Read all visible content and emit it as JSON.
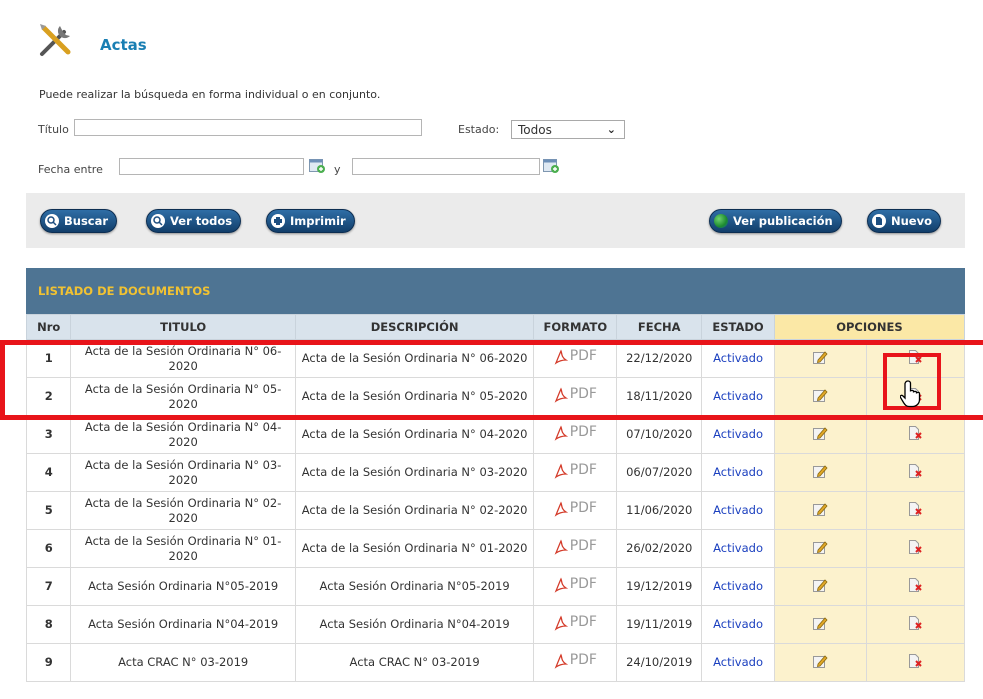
{
  "header": {
    "title": "Actas",
    "icon": "tools-icon"
  },
  "search": {
    "instructions": "Puede realizar la búsqueda en forma individual o en conjunto.",
    "titulo_label": "Título",
    "titulo_value": "",
    "estado_label": "Estado:",
    "estado_value": "Todos",
    "fecha_label": "Fecha entre",
    "fecha_from": "",
    "y_label": "y",
    "fecha_to": ""
  },
  "toolbar": {
    "buscar": "Buscar",
    "ver_todos": "Ver todos",
    "imprimir": "Imprimir",
    "ver_publicacion": "Ver publicación",
    "nuevo": "Nuevo"
  },
  "table": {
    "title": "LISTADO DE DOCUMENTOS",
    "headers": [
      "Nro",
      "TITULO",
      "DESCRIPCIÓN",
      "FORMATO",
      "FECHA",
      "ESTADO",
      "OPCIONES"
    ],
    "format_label": "PDF",
    "rows": [
      {
        "nro": "1",
        "titulo": "Acta de la Sesión Ordinaria N° 06-2020",
        "descripcion": "Acta de la Sesión Ordinaria N° 06-2020",
        "fecha": "22/12/2020",
        "estado": "Activado"
      },
      {
        "nro": "2",
        "titulo": "Acta de la Sesión Ordinaria N° 05-2020",
        "descripcion": "Acta de la Sesión Ordinaria N° 05-2020",
        "fecha": "18/11/2020",
        "estado": "Activado"
      },
      {
        "nro": "3",
        "titulo": "Acta de la Sesión Ordinaria N° 04-2020",
        "descripcion": "Acta de la Sesión Ordinaria N° 04-2020",
        "fecha": "07/10/2020",
        "estado": "Activado"
      },
      {
        "nro": "4",
        "titulo": "Acta de la Sesión Ordinaria N° 03-2020",
        "descripcion": "Acta de la Sesión Ordinaria N° 03-2020",
        "fecha": "06/07/2020",
        "estado": "Activado"
      },
      {
        "nro": "5",
        "titulo": "Acta de la Sesión Ordinaria N° 02-2020",
        "descripcion": "Acta de la Sesión Ordinaria N° 02-2020",
        "fecha": "11/06/2020",
        "estado": "Activado"
      },
      {
        "nro": "6",
        "titulo": "Acta de la Sesión Ordinaria N° 01-2020",
        "descripcion": "Acta de la Sesión Ordinaria N° 01-2020",
        "fecha": "26/02/2020",
        "estado": "Activado"
      },
      {
        "nro": "7",
        "titulo": "Acta Sesión Ordinaria N°05-2019",
        "descripcion": "Acta Sesión Ordinaria N°05-2019",
        "fecha": "19/12/2019",
        "estado": "Activado"
      },
      {
        "nro": "8",
        "titulo": "Acta Sesión Ordinaria N°04-2019",
        "descripcion": "Acta Sesión Ordinaria N°04-2019",
        "fecha": "19/11/2019",
        "estado": "Activado"
      },
      {
        "nro": "9",
        "titulo": "Acta CRAC N° 03-2019",
        "descripcion": "Acta CRAC N° 03-2019",
        "fecha": "24/10/2019",
        "estado": "Activado"
      }
    ]
  },
  "colors": {
    "accent": "#1a7fb3",
    "table_header_bg": "#4e7493",
    "table_title": "#f1c232",
    "highlight": "#e8141a",
    "options_bg": "#fcf2cd"
  }
}
